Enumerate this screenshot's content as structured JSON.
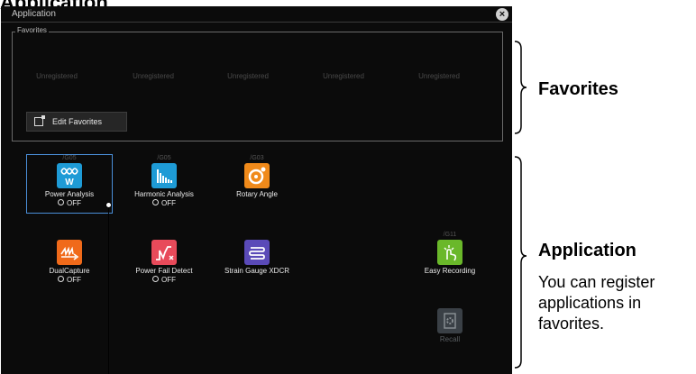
{
  "page_heading": "Application",
  "window": {
    "title": "Application",
    "close_icon": "close-icon"
  },
  "favorites": {
    "legend": "Favorites",
    "slots": [
      "Unregistered",
      "Unregistered",
      "Unregistered",
      "Unregistered",
      "Unregistered"
    ],
    "edit_label": "Edit Favorites"
  },
  "apps": [
    {
      "code": "/G05",
      "name": "Power Analysis",
      "state": "OFF",
      "color": "#1e9bd6",
      "icon": "wave-icon"
    },
    {
      "code": "/G05",
      "name": "Harmonic Analysis",
      "state": "OFF",
      "color": "#1e9bd6",
      "icon": "bar-icon"
    },
    {
      "code": "/G03",
      "name": "Rotary Angle",
      "state": "",
      "color": "#f08a1a",
      "icon": "rotary-icon"
    },
    {
      "code": "",
      "name": "DualCapture",
      "state": "OFF",
      "color": "#f06a1a",
      "icon": "dualcapture-icon"
    },
    {
      "code": "",
      "name": "Power Fail Detect",
      "state": "OFF",
      "color": "#e84a5a",
      "icon": "powerfail-icon"
    },
    {
      "code": "",
      "name": "Strain Gauge XDCR",
      "state": "",
      "color": "#5a4ab8",
      "icon": "strain-icon"
    },
    {
      "code": "/G11",
      "name": "Easy Recording",
      "state": "",
      "color": "#6ab82a",
      "icon": "touch-icon"
    },
    {
      "code": "",
      "name": "Recall",
      "state": "",
      "color": "#3a4046",
      "icon": "gear-icon"
    }
  ],
  "annotations": {
    "favorites": "Favorites",
    "application": "Application",
    "application_desc": "You can register applications in favorites."
  }
}
